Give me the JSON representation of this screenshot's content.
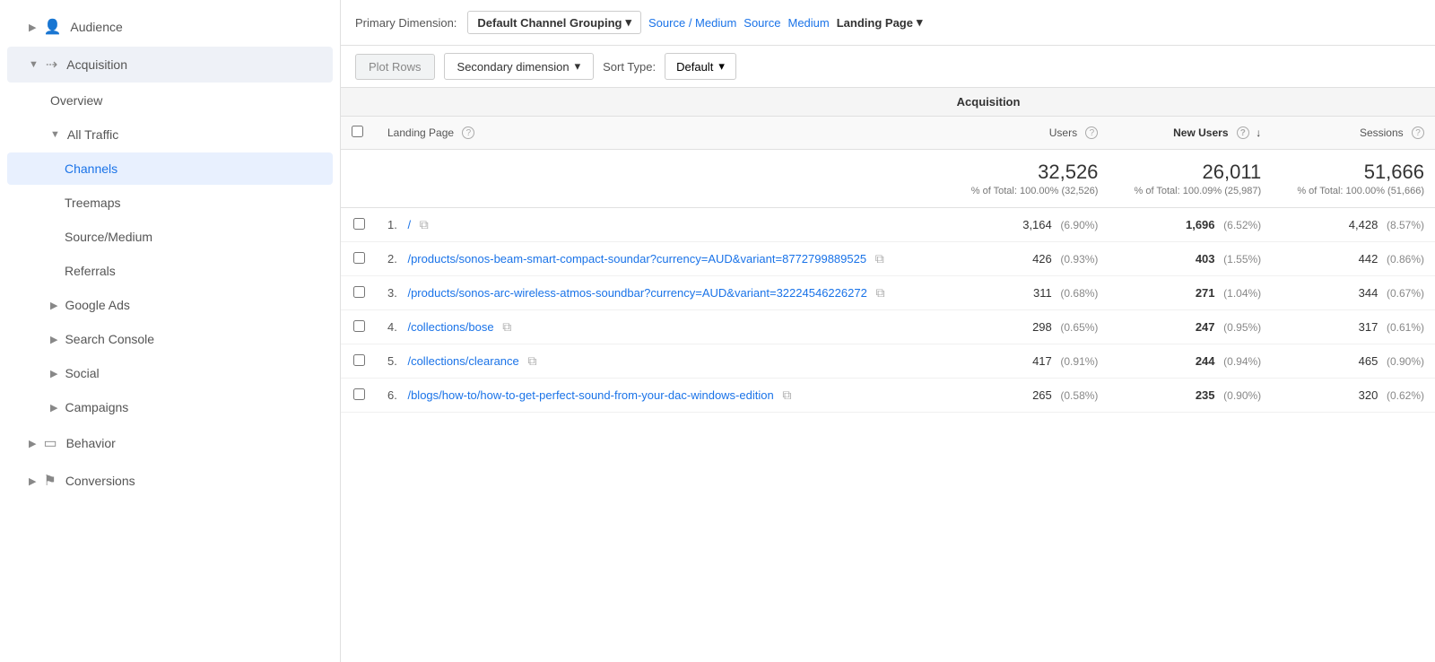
{
  "sidebar": {
    "items": [
      {
        "id": "audience",
        "label": "Audience",
        "icon": "👤",
        "level": 0,
        "expanded": false,
        "active": false
      },
      {
        "id": "acquisition",
        "label": "Acquisition",
        "icon": "⇢",
        "level": 0,
        "expanded": true,
        "active": false
      },
      {
        "id": "overview",
        "label": "Overview",
        "level": 1,
        "active": false
      },
      {
        "id": "all-traffic",
        "label": "All Traffic",
        "level": 1,
        "expanded": true,
        "active": false
      },
      {
        "id": "channels",
        "label": "Channels",
        "level": 2,
        "active": true
      },
      {
        "id": "treemaps",
        "label": "Treemaps",
        "level": 2,
        "active": false
      },
      {
        "id": "source-medium",
        "label": "Source/Medium",
        "level": 2,
        "active": false
      },
      {
        "id": "referrals",
        "label": "Referrals",
        "level": 2,
        "active": false
      },
      {
        "id": "google-ads",
        "label": "Google Ads",
        "level": 1,
        "expanded": false,
        "active": false
      },
      {
        "id": "search-console",
        "label": "Search Console",
        "level": 1,
        "expanded": false,
        "active": false
      },
      {
        "id": "social",
        "label": "Social",
        "level": 1,
        "expanded": false,
        "active": false
      },
      {
        "id": "campaigns",
        "label": "Campaigns",
        "level": 1,
        "expanded": false,
        "active": false
      },
      {
        "id": "behavior",
        "label": "Behavior",
        "icon": "▭",
        "level": 0,
        "expanded": false,
        "active": false
      },
      {
        "id": "conversions",
        "label": "Conversions",
        "icon": "⚑",
        "level": 0,
        "expanded": false,
        "active": false
      }
    ]
  },
  "dimension_bar": {
    "primary_label": "Primary Dimension:",
    "default_channel": "Default Channel Grouping",
    "source_medium": "Source / Medium",
    "source": "Source",
    "medium": "Medium",
    "landing_page": "Landing Page"
  },
  "toolbar": {
    "plot_rows": "Plot Rows",
    "secondary_dimension": "Secondary dimension",
    "sort_type_label": "Sort Type:",
    "sort_default": "Default"
  },
  "table": {
    "section_header": "Acquisition",
    "col_landing_page": "Landing Page",
    "col_users": "Users",
    "col_new_users": "New Users",
    "col_sessions": "Sessions",
    "totals": {
      "users": "32,526",
      "users_pct": "% of Total: 100.00% (32,526)",
      "new_users": "26,011",
      "new_users_pct": "% of Total: 100.09% (25,987)",
      "sessions": "51,666",
      "sessions_pct": "% of Total: 100.00% (51,666)"
    },
    "rows": [
      {
        "num": "1.",
        "page": "/",
        "users": "3,164",
        "users_pct": "(6.90%)",
        "new_users": "1,696",
        "new_users_pct": "(6.52%)",
        "sessions": "4,428",
        "sessions_pct": "(8.57%)"
      },
      {
        "num": "2.",
        "page": "/products/sonos-beam-smart-compact-soundar?currency=AUD&variant=8772799889525",
        "users": "426",
        "users_pct": "(0.93%)",
        "new_users": "403",
        "new_users_pct": "(1.55%)",
        "sessions": "442",
        "sessions_pct": "(0.86%)"
      },
      {
        "num": "3.",
        "page": "/products/sonos-arc-wireless-atmos-soundbar?currency=AUD&variant=32224546226272",
        "users": "311",
        "users_pct": "(0.68%)",
        "new_users": "271",
        "new_users_pct": "(1.04%)",
        "sessions": "344",
        "sessions_pct": "(0.67%)"
      },
      {
        "num": "4.",
        "page": "/collections/bose",
        "users": "298",
        "users_pct": "(0.65%)",
        "new_users": "247",
        "new_users_pct": "(0.95%)",
        "sessions": "317",
        "sessions_pct": "(0.61%)"
      },
      {
        "num": "5.",
        "page": "/collections/clearance",
        "users": "417",
        "users_pct": "(0.91%)",
        "new_users": "244",
        "new_users_pct": "(0.94%)",
        "sessions": "465",
        "sessions_pct": "(0.90%)"
      },
      {
        "num": "6.",
        "page": "/blogs/how-to/how-to-get-perfect-sound-from-your-dac-windows-edition",
        "users": "265",
        "users_pct": "(0.58%)",
        "new_users": "235",
        "new_users_pct": "(0.90%)",
        "sessions": "320",
        "sessions_pct": "(0.62%)"
      }
    ]
  }
}
